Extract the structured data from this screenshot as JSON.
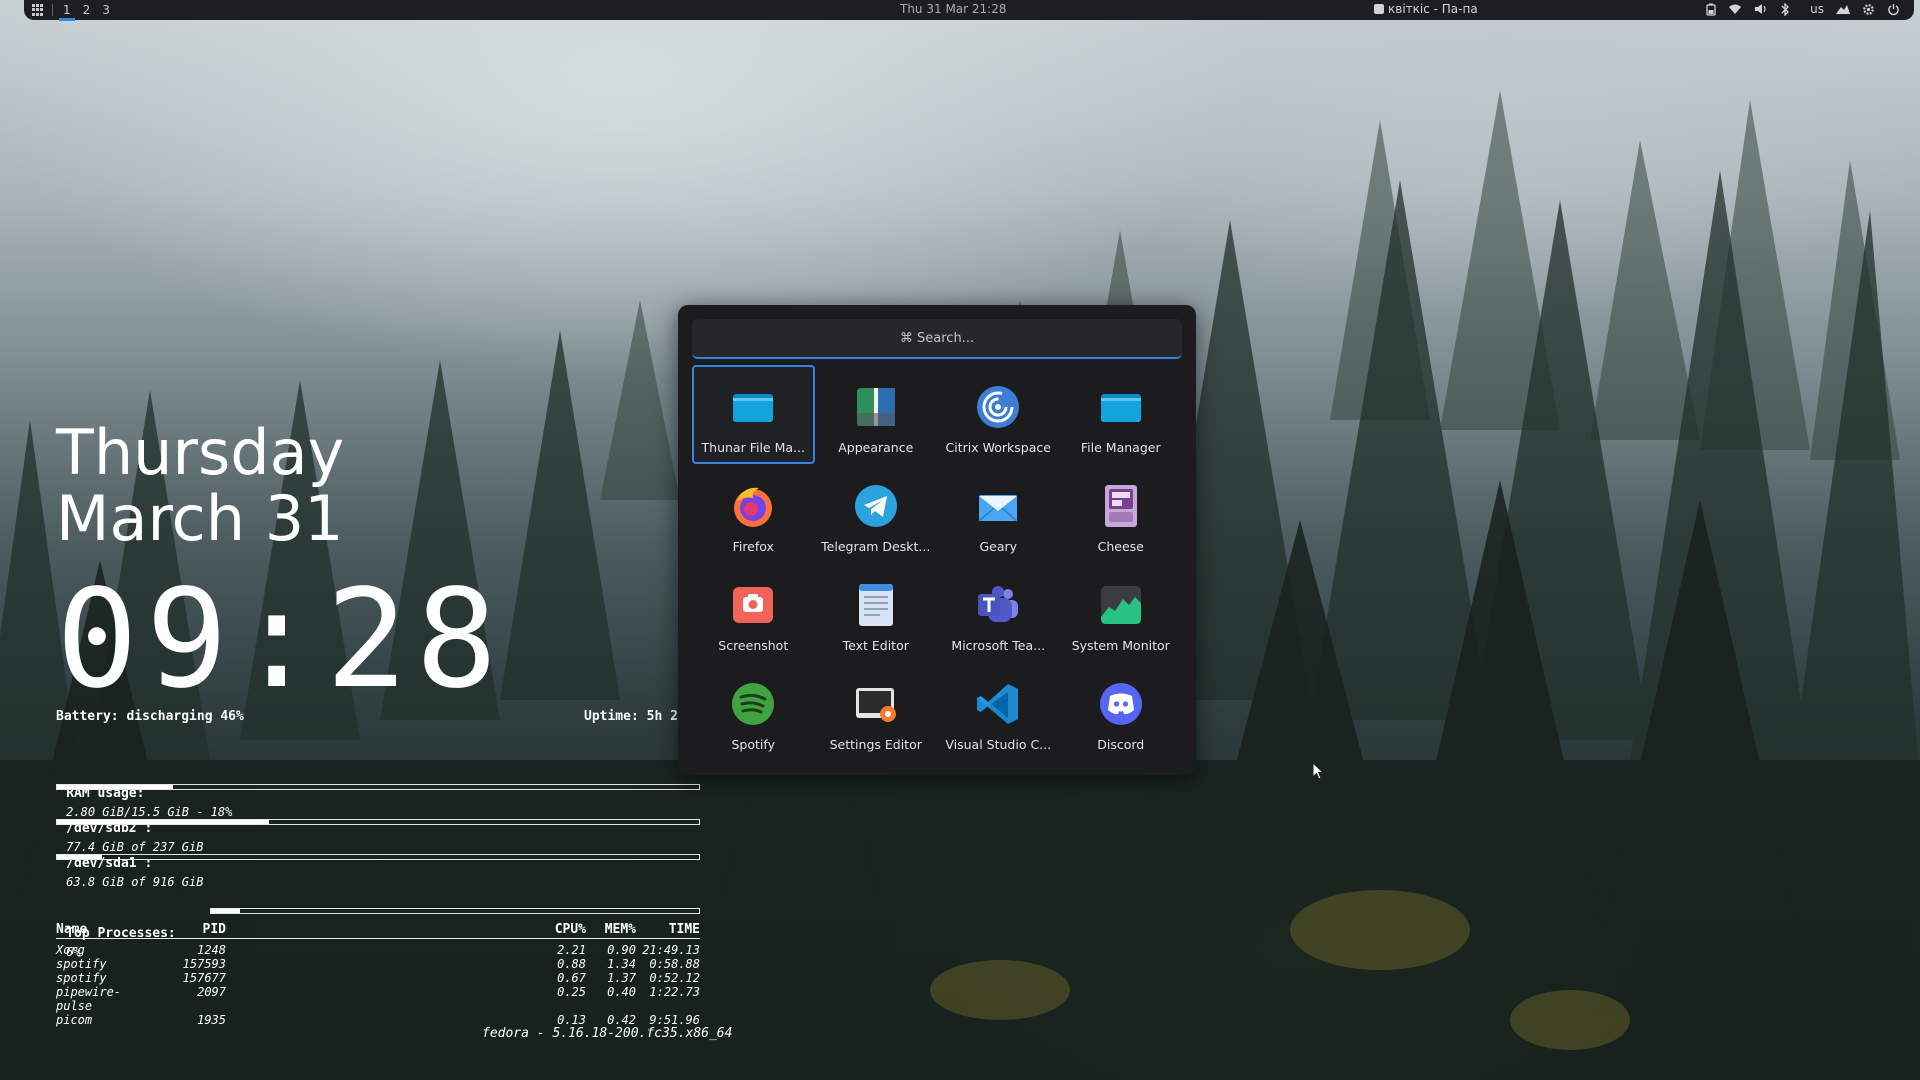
{
  "topbar": {
    "workspaces": [
      "1",
      "2",
      "3"
    ],
    "datetime": "Thu 31 Mar 21:28",
    "media": "квіткіс - Па-па",
    "keyboard_layout": "us"
  },
  "conky": {
    "day": "Thursday",
    "date": "March 31",
    "time": "09:28  PM",
    "battery": "Battery: discharging 46%",
    "uptime": "Uptime: 5h 2",
    "ram_label": "RAM usage:",
    "ram_value": "2.80 GiB/15.5 GiB - 18%",
    "ram_fraction": 0.18,
    "disk1_label": "/dev/sdb2 :",
    "disk1_value": "77.4 GiB of 237 GiB",
    "disk1_fraction": 0.33,
    "disk2_label": "/dev/sda1 :",
    "disk2_value": "63.8 GiB of 916 GiB",
    "disk2_fraction": 0.07,
    "top_label": "Top Processes:",
    "top_value": "6%",
    "top_fraction": 0.06,
    "proc_headers": {
      "name": "Name",
      "pid": "PID",
      "cpu": "CPU%",
      "mem": "MEM%",
      "time": "TIME"
    },
    "processes": [
      {
        "name": "Xorg",
        "pid": "1248",
        "cpu": "2.21",
        "mem": "0.90",
        "time": "21:49.13"
      },
      {
        "name": "spotify",
        "pid": "157593",
        "cpu": "0.88",
        "mem": "1.34",
        "time": "0:58.88"
      },
      {
        "name": "spotify",
        "pid": "157677",
        "cpu": "0.67",
        "mem": "1.37",
        "time": "0:52.12"
      },
      {
        "name": "pipewire-pulse",
        "pid": "2097",
        "cpu": "0.25",
        "mem": "0.40",
        "time": "1:22.73"
      },
      {
        "name": "picom",
        "pid": "1935",
        "cpu": "0.13",
        "mem": "0.42",
        "time": "9:51.96"
      }
    ],
    "kernel": "fedora - 5.16.18-200.fc35.x86_64"
  },
  "launcher": {
    "search_placeholder": "⌘ Search...",
    "apps": [
      {
        "label": "Thunar File Ma...",
        "icon": "folder-icon"
      },
      {
        "label": "Appearance",
        "icon": "appearance-icon"
      },
      {
        "label": "Citrix Workspace",
        "icon": "citrix-icon"
      },
      {
        "label": "File Manager",
        "icon": "folder-icon"
      },
      {
        "label": "Firefox",
        "icon": "firefox-icon"
      },
      {
        "label": "Telegram Deskt...",
        "icon": "telegram-icon"
      },
      {
        "label": "Geary",
        "icon": "mail-icon"
      },
      {
        "label": "Cheese",
        "icon": "cheese-icon"
      },
      {
        "label": "Screenshot",
        "icon": "camera-icon"
      },
      {
        "label": "Text Editor",
        "icon": "text-editor-icon"
      },
      {
        "label": "Microsoft Tea...",
        "icon": "teams-icon"
      },
      {
        "label": "System Monitor",
        "icon": "system-monitor-icon"
      },
      {
        "label": "Spotify",
        "icon": "spotify-icon"
      },
      {
        "label": "Settings Editor",
        "icon": "settings-editor-icon"
      },
      {
        "label": "Visual Studio C...",
        "icon": "vscode-icon"
      },
      {
        "label": "Discord",
        "icon": "discord-icon"
      }
    ]
  },
  "colors": {
    "accent": "#3584e4"
  }
}
